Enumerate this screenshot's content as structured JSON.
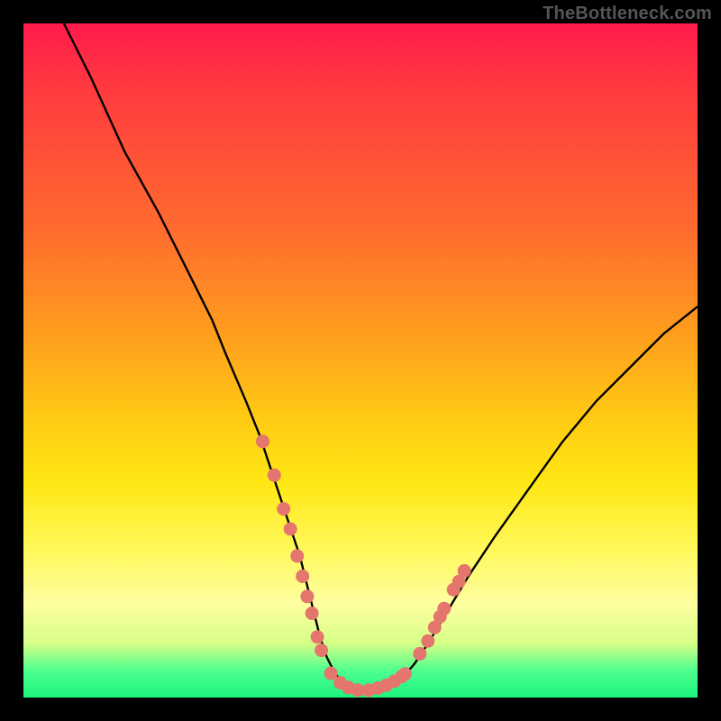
{
  "watermark": "TheBottleneck.com",
  "colors": {
    "frame": "#000000",
    "curve": "#000000",
    "dot": "#e4766d",
    "gradient_top": "#ff1a4b",
    "gradient_bottom": "#1cf47e"
  },
  "chart_data": {
    "type": "line",
    "title": "",
    "xlabel": "",
    "ylabel": "",
    "xlim": [
      0,
      100
    ],
    "ylim": [
      0,
      100
    ],
    "grid": false,
    "legend": false,
    "note": "Axes are unlabeled in the source image; x and y are normalized 0–100. y represents bottleneck percentage (lower = better / greener). Values are read from pixel positions.",
    "series": [
      {
        "name": "bottleneck-curve",
        "x": [
          6,
          10,
          15,
          20,
          25,
          28,
          30,
          33,
          35,
          37,
          39,
          41,
          43,
          44,
          45,
          46,
          47,
          48,
          49,
          50,
          52,
          54,
          56,
          58,
          60,
          63,
          66,
          70,
          75,
          80,
          85,
          90,
          95,
          100
        ],
        "y": [
          100,
          92,
          81,
          72,
          62,
          56,
          51,
          44,
          39,
          33,
          27,
          21,
          13,
          9,
          6,
          4,
          2.5,
          1.6,
          1.1,
          1,
          1.1,
          1.6,
          2.7,
          5,
          8,
          13,
          18,
          24,
          31,
          38,
          44,
          49,
          54,
          58
        ]
      }
    ],
    "scatter": [
      {
        "name": "highlighted-points-left",
        "x": [
          35.5,
          37.2,
          38.6,
          39.6,
          40.6,
          41.4,
          42.1,
          42.8,
          43.6,
          44.2
        ],
        "y": [
          38,
          33,
          28,
          25,
          21,
          18,
          15,
          12.5,
          9,
          7
        ]
      },
      {
        "name": "highlighted-points-bottom",
        "x": [
          45.6,
          47.0,
          48.2,
          49.6,
          51.2,
          52.6,
          53.8,
          55.0,
          56.1,
          56.6
        ],
        "y": [
          3.6,
          2.2,
          1.5,
          1.1,
          1.1,
          1.4,
          1.8,
          2.4,
          3.1,
          3.5
        ]
      },
      {
        "name": "highlighted-points-right",
        "x": [
          58.8,
          60.0,
          61.0,
          61.8,
          62.4,
          63.8,
          64.6,
          65.4
        ],
        "y": [
          6.5,
          8.4,
          10.4,
          12,
          13.2,
          16,
          17.2,
          18.8
        ]
      }
    ]
  }
}
